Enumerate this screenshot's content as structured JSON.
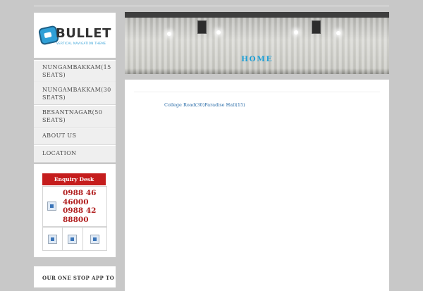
{
  "logo": {
    "word": "BULLET",
    "tagline": "VERTICAL NAVIGATION THEME",
    "colors": {
      "accent": "#2f9fd6",
      "text": "#333333"
    }
  },
  "menu": {
    "items": [
      {
        "label": "NUNGAMBAKKAM(15 SEATS)"
      },
      {
        "label": "NUNGAMBAKKAM(30 SEATS)"
      },
      {
        "label": "BESANTNAGAR(50 SEATS)"
      },
      {
        "label": "ABOUT US"
      },
      {
        "label": "LOCATION"
      }
    ]
  },
  "enquiry": {
    "title": "Enquiry Desk",
    "phone": "0988 46 46000 0988 42 88800",
    "icons": [
      "image-icon",
      "image-icon",
      "image-icon",
      "image-icon"
    ],
    "colors": {
      "header": "#c51d1d",
      "phone": "#b01c1c"
    }
  },
  "app_promo": {
    "text": "OUR ONE STOP APP TO"
  },
  "banner": {
    "title": "HOME",
    "title_color": "#1d9fd6"
  },
  "content": {
    "link_1": "College Road(30)",
    "link_2": "Paradise Hall(15)",
    "link_color": "#2b6da8"
  }
}
